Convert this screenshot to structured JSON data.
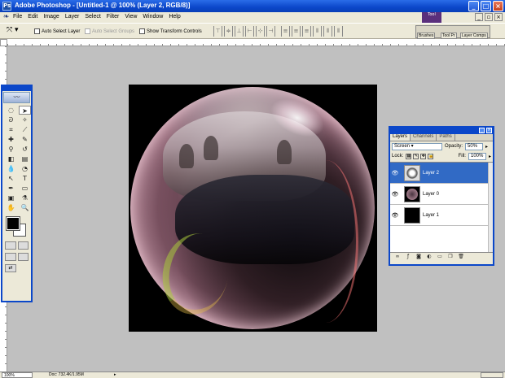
{
  "window": {
    "title": "Adobe Photoshop - [Untitled-1 @ 100% (Layer 2, RGB/8)]"
  },
  "menu": [
    "File",
    "Edit",
    "Image",
    "Layer",
    "Select",
    "Filter",
    "View",
    "Window",
    "Help"
  ],
  "options": {
    "auto_select_layer": "Auto Select Layer",
    "auto_select_groups": "Auto Select Groups",
    "show_transform_controls": "Show Transform Controls"
  },
  "palette_well": {
    "tabs": [
      "Brushes",
      "Tool Pr",
      "Layer Comps"
    ],
    "logo": "Tool"
  },
  "layers_panel": {
    "tabs": [
      "Layers",
      "Channels",
      "Paths"
    ],
    "blend_mode": "Screen",
    "opacity_label": "Opacity:",
    "opacity_value": "50%",
    "lock_label": "Lock:",
    "fill_label": "Fill:",
    "fill_value": "100%",
    "layers": [
      {
        "name": "Layer 2",
        "selected": true
      },
      {
        "name": "Layer 0",
        "selected": false
      },
      {
        "name": "Layer 1",
        "selected": false
      }
    ]
  },
  "status": {
    "zoom": "100%",
    "doc": "Doc: 732.4K/1.95M"
  },
  "colors": {
    "foreground": "#000000",
    "background": "#ffffff",
    "selection": "#316ac5",
    "title_bar": "#0b47c9"
  }
}
